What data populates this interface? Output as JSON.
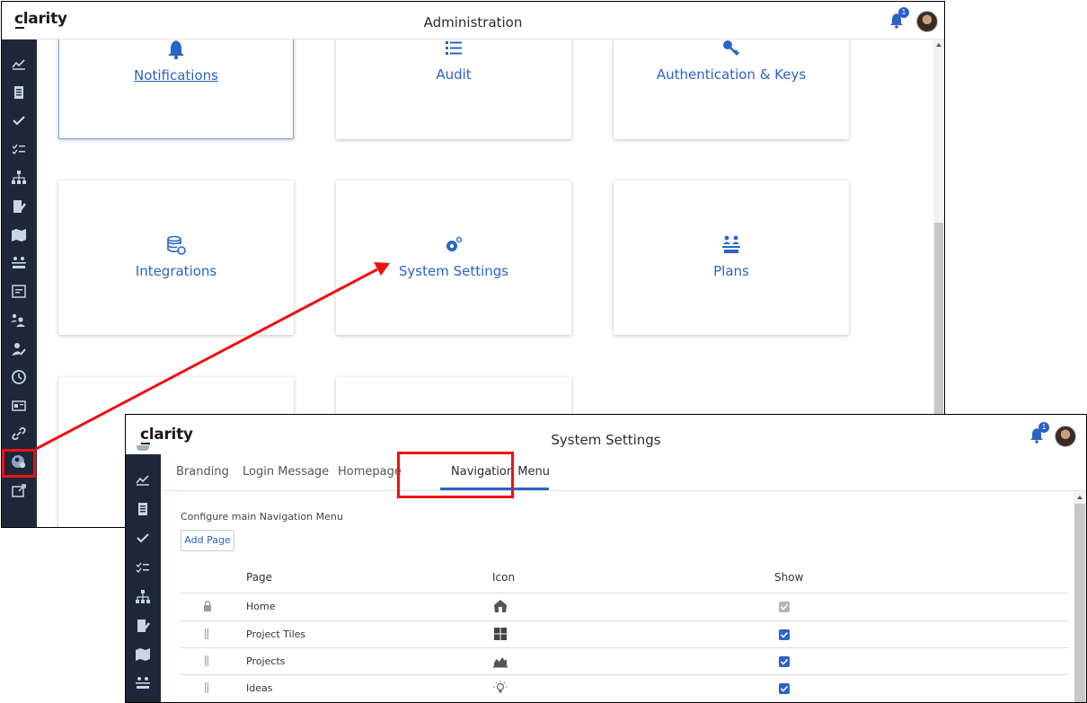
{
  "window1": {
    "logo": "clarity",
    "title": "Administration",
    "notification_count": "1",
    "tiles": [
      {
        "label": "Notifications",
        "icon": "bell-icon"
      },
      {
        "label": "Audit",
        "icon": "list-icon"
      },
      {
        "label": "Authentication & Keys",
        "icon": "key-icon"
      },
      {
        "label": "Integrations",
        "icon": "database-sync-icon"
      },
      {
        "label": "System Settings",
        "icon": "gears-icon"
      },
      {
        "label": "Plans",
        "icon": "plans-icon"
      }
    ],
    "sidebar_icons": [
      "dashboard-icon",
      "trend-icon",
      "clipboard-icon",
      "check-icon",
      "checklist-icon",
      "hierarchy-icon",
      "document-edit-icon",
      "map-icon",
      "people-plan-icon",
      "report-icon",
      "team-icon",
      "user-edit-icon",
      "clock-icon",
      "cards-icon",
      "link-icon",
      "admin-settings-icon",
      "external-link-icon"
    ]
  },
  "window2": {
    "logo": "clarity",
    "title": "System Settings",
    "notification_count": "1",
    "tabs": [
      "Branding",
      "Login Message",
      "Homepage",
      "Navigation Menu"
    ],
    "active_tab": "Navigation Menu",
    "subtitle": "Configure main Navigation Menu",
    "add_button": "Add Page",
    "columns": {
      "page": "Page",
      "icon": "Icon",
      "show": "Show"
    },
    "rows": [
      {
        "page": "Home",
        "icon": "home-icon",
        "show": true,
        "locked": true
      },
      {
        "page": "Project Tiles",
        "icon": "tiles-icon",
        "show": true,
        "locked": false
      },
      {
        "page": "Projects",
        "icon": "projects-chart-icon",
        "show": true,
        "locked": false
      },
      {
        "page": "Ideas",
        "icon": "lightbulb-icon",
        "show": true,
        "locked": false
      }
    ]
  },
  "colors": {
    "accent": "#2b63c6",
    "sidebar": "#1d2737",
    "annotation": "#ee1111"
  }
}
